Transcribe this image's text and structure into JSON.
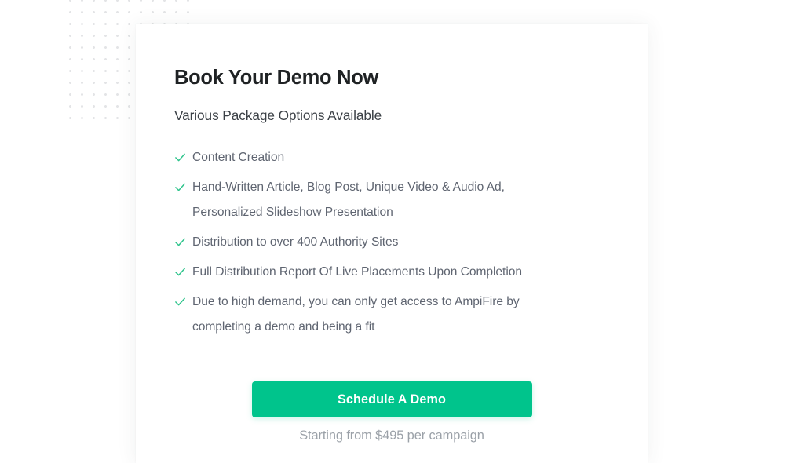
{
  "theme": {
    "page_background": "#ffffff",
    "card_background": "#ffffff",
    "accent_green": "#00c48c",
    "check_green": "#2ec48c",
    "heading_color": "#1f2224",
    "subheading_color": "#3b4046",
    "body_color": "#5f6571",
    "muted_color": "#9ba1a8",
    "dot_color": "#e3e4e6"
  },
  "decor": {
    "dot_grid_name": "dot-grid-pattern"
  },
  "card": {
    "heading": "Book Your Demo Now",
    "subheading": "Various Package Options Available",
    "features": [
      {
        "icon": "check-icon",
        "text": "Content Creation"
      },
      {
        "icon": "check-icon",
        "text": "Hand-Written Article, Blog Post, Unique Video & Audio Ad, Personalized Slideshow Presentation"
      },
      {
        "icon": "check-icon",
        "text": "Distribution to over 400 Authority Sites"
      },
      {
        "icon": "check-icon",
        "text": "Full Distribution Report Of Live Placements Upon Completion"
      },
      {
        "icon": "check-icon",
        "text": "Due to high demand, you can only get access to AmpiFire by completing a demo and being a fit"
      }
    ],
    "cta": {
      "label": "Schedule A Demo"
    },
    "price_note": "Starting from $495 per campaign"
  }
}
